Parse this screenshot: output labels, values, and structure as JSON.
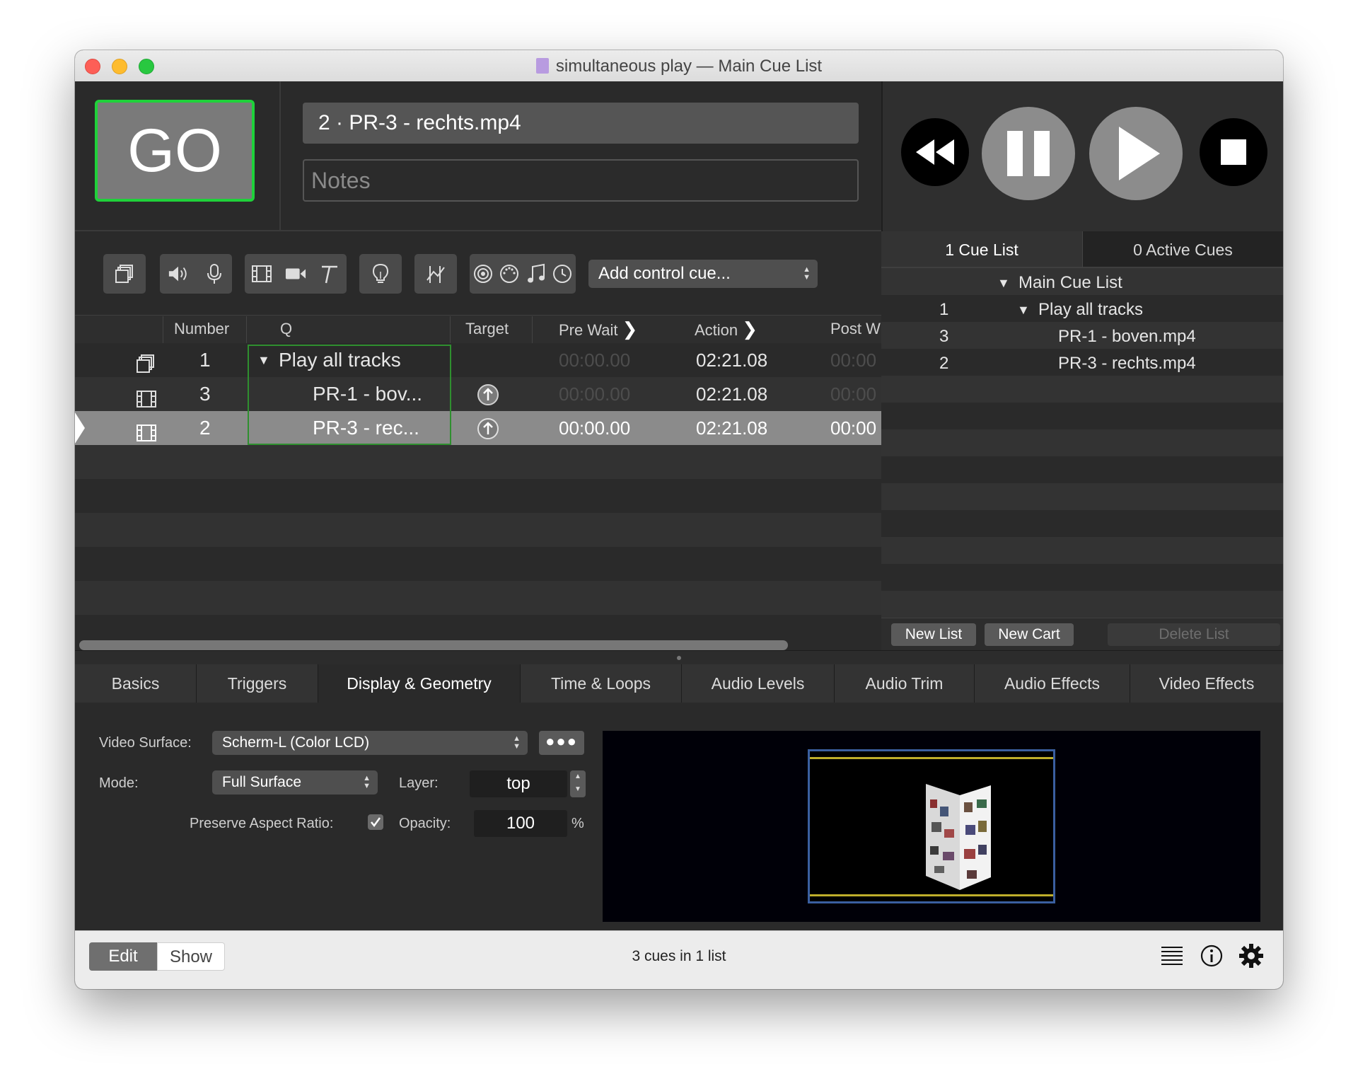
{
  "window": {
    "title": "simultaneous play — Main Cue List"
  },
  "go_label": "GO",
  "cue_name": "2 · PR-3 - rechts.mp4",
  "notes_placeholder": "Notes",
  "toolbar": {
    "add_control_cue": "Add control cue..."
  },
  "table": {
    "headers": {
      "number": "Number",
      "q": "Q",
      "target": "Target",
      "pre_wait": "Pre Wait",
      "action": "Action",
      "post_wait": "Post W"
    },
    "rows": [
      {
        "number": "1",
        "q": "Play all tracks",
        "pre_wait": "00:00.00",
        "action": "02:21.08",
        "post_wait": "00:00"
      },
      {
        "number": "3",
        "q": "PR-1 - bov...",
        "pre_wait": "00:00.00",
        "action": "02:21.08",
        "post_wait": "00:00"
      },
      {
        "number": "2",
        "q": "PR-3 - rec...",
        "pre_wait": "00:00.00",
        "action": "02:21.08",
        "post_wait": "00:00"
      }
    ]
  },
  "sidebar": {
    "tab_cue_lists": "1 Cue List",
    "tab_active_cues": "0 Active Cues",
    "tree": [
      {
        "number": "",
        "name": "Main Cue List"
      },
      {
        "number": "1",
        "name": "Play all tracks"
      },
      {
        "number": "3",
        "name": "PR-1 - boven.mp4"
      },
      {
        "number": "2",
        "name": "PR-3 - rechts.mp4"
      }
    ],
    "new_list": "New List",
    "new_cart": "New Cart",
    "delete_list": "Delete List"
  },
  "inspector": {
    "tabs": [
      "Basics",
      "Triggers",
      "Display & Geometry",
      "Time & Loops",
      "Audio Levels",
      "Audio Trim",
      "Audio Effects",
      "Video Effects"
    ],
    "active_tab": "Display & Geometry",
    "video_surface_label": "Video Surface:",
    "video_surface_value": "Scherm-L (Color LCD)",
    "mode_label": "Mode:",
    "mode_value": "Full Surface",
    "layer_label": "Layer:",
    "layer_value": "top",
    "preserve_label": "Preserve Aspect Ratio:",
    "opacity_label": "Opacity:",
    "opacity_value": "100",
    "percent": "%"
  },
  "status": {
    "edit": "Edit",
    "show": "Show",
    "summary": "3 cues in 1 list"
  },
  "colors": {
    "go_border": "#1fd13a",
    "selection": "#8b8b8b",
    "group_outline": "#2f8f2f"
  }
}
